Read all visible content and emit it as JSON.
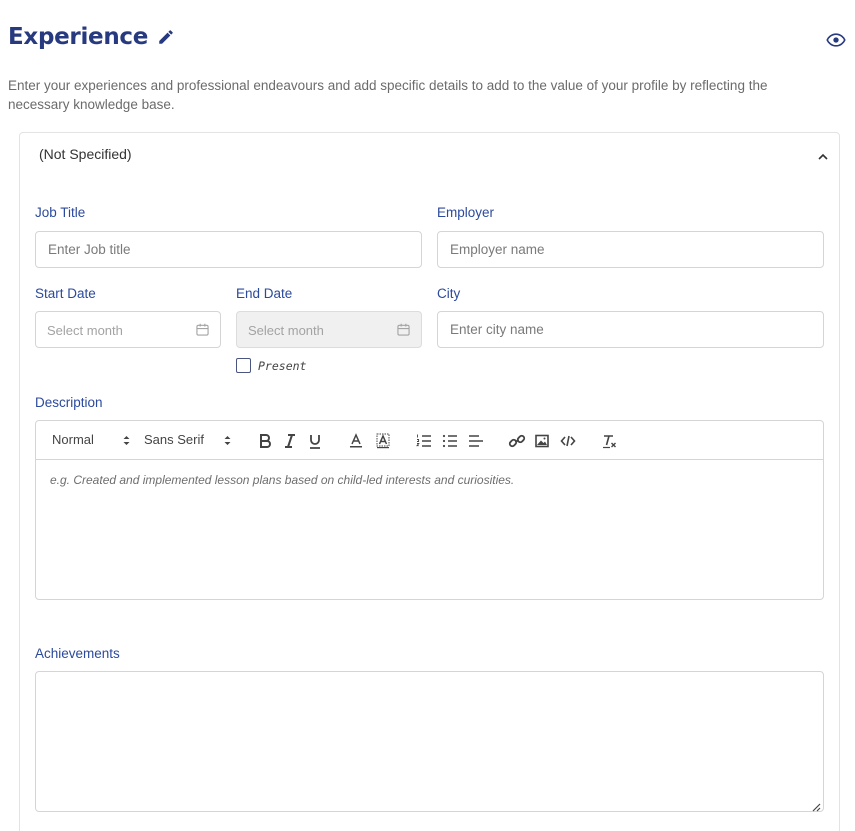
{
  "section": {
    "title": "Experience",
    "description": "Enter your experiences and professional endeavours and add specific details to add to the value of your profile by reflecting the necessary knowledge base."
  },
  "entry": {
    "header_title": "(Not Specified)"
  },
  "form": {
    "job_title_label": "Job Title",
    "job_title_placeholder": "Enter Job title",
    "employer_label": "Employer",
    "employer_placeholder": "Employer name",
    "start_date_label": "Start Date",
    "start_date_placeholder": "Select month",
    "end_date_label": "End Date",
    "end_date_placeholder": "Select month",
    "city_label": "City",
    "city_placeholder": "Enter city name",
    "present_label": "Present",
    "present_checked": false,
    "description_label": "Description",
    "description_placeholder": "e.g.  Created and implemented lesson plans based on child-led interests and curiosities.",
    "achievements_label": "Achievements"
  },
  "toolbar": {
    "format_value": "Normal",
    "font_value": "Sans Serif",
    "buttons": [
      "bold-icon",
      "italic-icon",
      "underline-icon",
      "text-color-icon",
      "background-color-icon",
      "ordered-list-icon",
      "bullet-list-icon",
      "align-icon",
      "link-icon",
      "image-icon",
      "code-icon",
      "clear-format-icon"
    ]
  },
  "colors": {
    "title": "#27397f",
    "label": "#2c4a9c",
    "border": "#d5d5d5",
    "disabled_bg": "#f0f0f0"
  }
}
